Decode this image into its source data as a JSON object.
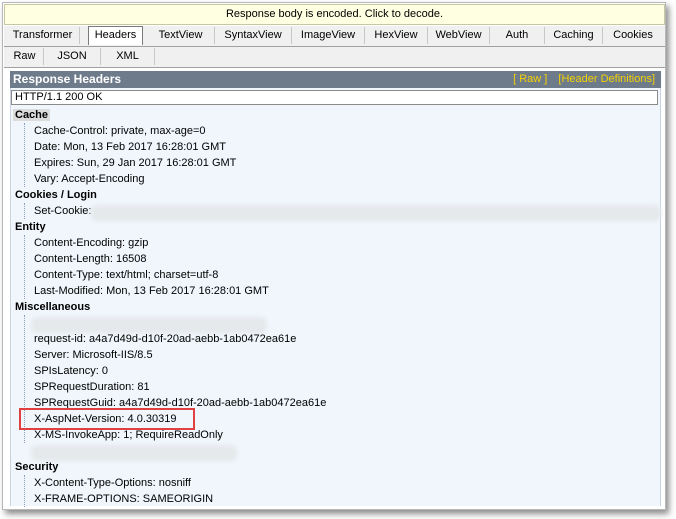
{
  "notice": "Response body is encoded. Click to decode.",
  "tabs_row1": [
    "Transformer",
    "Headers",
    "TextView",
    "SyntaxView",
    "ImageView",
    "HexView",
    "WebView",
    "Auth",
    "Caching",
    "Cookies"
  ],
  "tabs_row2": [
    "Raw",
    "JSON",
    "XML"
  ],
  "response_headers": {
    "title": "Response Headers",
    "raw_link": "[ Raw ]",
    "defs_link": "[Header Definitions]",
    "status_line": "HTTP/1.1 200 OK"
  },
  "sections": {
    "cache": {
      "title": "Cache",
      "lines": [
        "Cache-Control: private, max-age=0",
        "Date: Mon, 13 Feb 2017 16:28:01 GMT",
        "Expires: Sun, 29 Jan 2017 16:28:01 GMT",
        "Vary: Accept-Encoding"
      ]
    },
    "cookies": {
      "title": "Cookies / Login",
      "lines": [
        "Set-Cookie:"
      ]
    },
    "entity": {
      "title": "Entity",
      "lines": [
        "Content-Encoding: gzip",
        "Content-Length: 16508",
        "Content-Type: text/html; charset=utf-8",
        "Last-Modified: Mon, 13 Feb 2017 16:28:01 GMT"
      ]
    },
    "misc": {
      "title": "Miscellaneous",
      "lines": [
        "request-id: a4a7d49d-d10f-20ad-aebb-1ab0472ea61e",
        "Server: Microsoft-IIS/8.5",
        "SPIsLatency: 0",
        "SPRequestDuration: 81",
        "SPRequestGuid: a4a7d49d-d10f-20ad-aebb-1ab0472ea61e",
        "X-AspNet-Version: 4.0.30319",
        "X-MS-InvokeApp: 1; RequireReadOnly"
      ]
    },
    "security": {
      "title": "Security",
      "lines": [
        "X-Content-Type-Options: nosniff",
        "X-FRAME-OPTIONS: SAMEORIGIN"
      ]
    }
  }
}
